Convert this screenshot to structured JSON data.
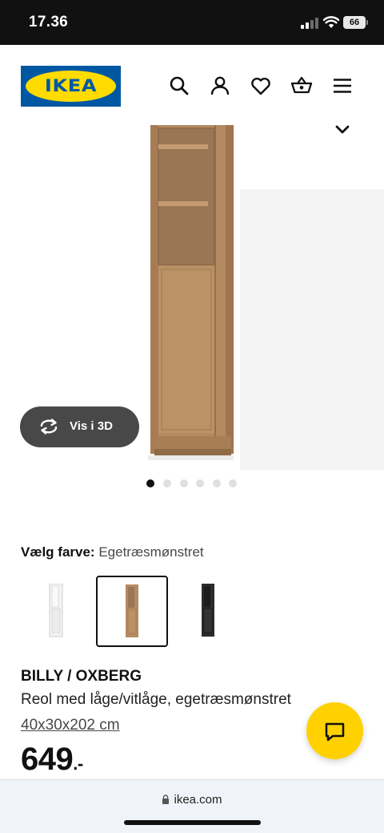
{
  "status_bar": {
    "time": "17.36",
    "battery": "66"
  },
  "header": {
    "logo_text": "IKEA",
    "icons": [
      "search-icon",
      "user-icon",
      "heart-icon",
      "basket-icon",
      "menu-icon"
    ]
  },
  "gallery": {
    "view_3d_label": "Vis i 3D",
    "image_count": 6,
    "active_index": 0
  },
  "color_picker": {
    "label": "Vælg farve:",
    "value": "Egetræsmønstret",
    "options": [
      {
        "name": "white",
        "color": "#f3f3f3",
        "selected": false
      },
      {
        "name": "oak",
        "color": "#b48a62",
        "selected": true
      },
      {
        "name": "black",
        "color": "#2b2b2b",
        "selected": false
      }
    ]
  },
  "product": {
    "name": "BILLY / OXBERG",
    "description": "Reol med låge/vitlåge, egetræsmønstret",
    "size": "40x30x202 cm",
    "price": "649",
    "price_suffix": ".-"
  },
  "browser": {
    "url": "ikea.com"
  },
  "colors": {
    "ikea_blue": "#0058a3",
    "ikea_yellow": "#ffdb00",
    "chat_yellow": "#ffd100"
  }
}
